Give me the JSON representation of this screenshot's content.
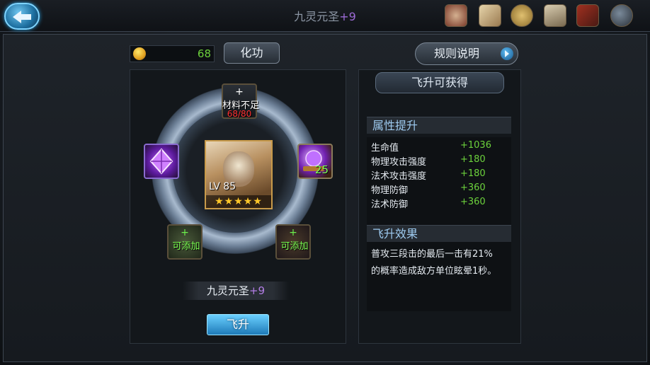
{
  "header": {
    "title": "九灵元圣",
    "title_plus": "+9",
    "icons": [
      "map-scroll-icon",
      "parchment-icon",
      "coin-medal-icon",
      "notice-scroll-icon",
      "book-icon",
      "magnifier-icon"
    ]
  },
  "currency": {
    "value": "68"
  },
  "buttons": {
    "huagong": "化功",
    "rules": "规则说明",
    "feisheng": "飞升"
  },
  "slots": {
    "top": {
      "plus": "+",
      "text": "材料不足",
      "count": "68/80"
    },
    "right": {
      "count": "25"
    },
    "bottom_left": {
      "plus": "+",
      "text": "可添加"
    },
    "bottom_right": {
      "plus": "+",
      "text": "可添加"
    }
  },
  "hero": {
    "level": "LV 85",
    "stars": "★★★★★",
    "name": "九灵元圣",
    "name_plus": "+9"
  },
  "reward": {
    "title": "飞升可获得",
    "attr_header": "属性提升",
    "stats": [
      {
        "label": "生命值",
        "value": "+1036"
      },
      {
        "label": "物理攻击强度",
        "value": "+180"
      },
      {
        "label": "法术攻击强度",
        "value": "+180"
      },
      {
        "label": "物理防御",
        "value": "+360"
      },
      {
        "label": "法术防御",
        "value": "+360"
      }
    ],
    "effect_header": "飞升效果",
    "effect_line1": "普攻三段击的最后一击有21%",
    "effect_line2": "的概率造成敌方单位眩晕1秒。"
  },
  "colors": {
    "accent_green": "#6cd23c",
    "warning_red": "#ff3030",
    "purple_plus": "#9d6bd6",
    "button_blue": "#1e7ab8"
  }
}
